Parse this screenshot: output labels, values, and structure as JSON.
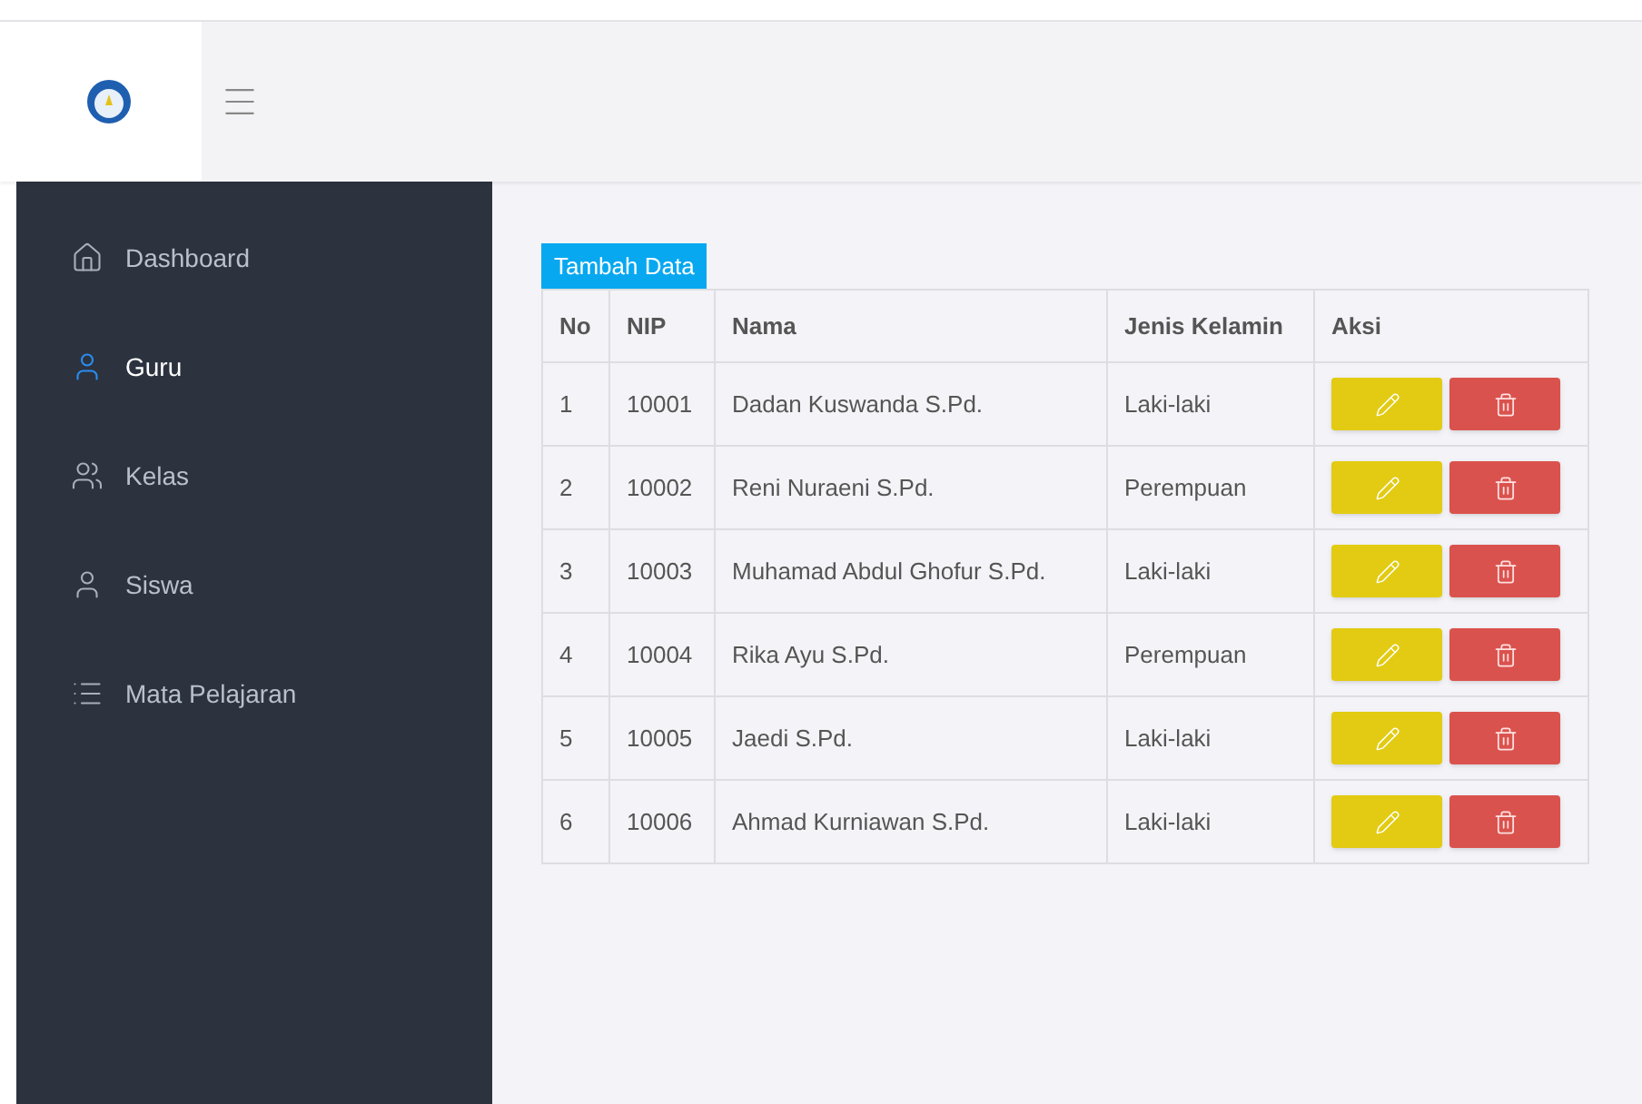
{
  "sidebar": {
    "items": [
      {
        "label": "Dashboard",
        "kind": "home",
        "selected": false
      },
      {
        "label": "Guru",
        "kind": "user",
        "selected": true
      },
      {
        "label": "Kelas",
        "kind": "users",
        "selected": false
      },
      {
        "label": "Siswa",
        "kind": "user",
        "selected": false
      },
      {
        "label": "Mata Pelajaran",
        "kind": "list",
        "selected": false
      }
    ]
  },
  "add_button": "Tambah Data",
  "table": {
    "columns": [
      "No",
      "NIP",
      "Nama",
      "Jenis Kelamin",
      "Aksi"
    ],
    "rows": [
      {
        "no": "1",
        "nip": "10001",
        "nama": "Dadan Kuswanda S.Pd.",
        "jenis_kelamin": "Laki-laki"
      },
      {
        "no": "2",
        "nip": "10002",
        "nama": "Reni Nuraeni S.Pd.",
        "jenis_kelamin": "Perempuan"
      },
      {
        "no": "3",
        "nip": "10003",
        "nama": "Muhamad Abdul Ghofur S.Pd.",
        "jenis_kelamin": "Laki-laki"
      },
      {
        "no": "4",
        "nip": "10004",
        "nama": "Rika Ayu S.Pd.",
        "jenis_kelamin": "Perempuan"
      },
      {
        "no": "5",
        "nip": "10005",
        "nama": "Jaedi S.Pd.",
        "jenis_kelamin": "Laki-laki"
      },
      {
        "no": "6",
        "nip": "10006",
        "nama": "Ahmad Kurniawan S.Pd.",
        "jenis_kelamin": "Laki-laki"
      }
    ]
  }
}
